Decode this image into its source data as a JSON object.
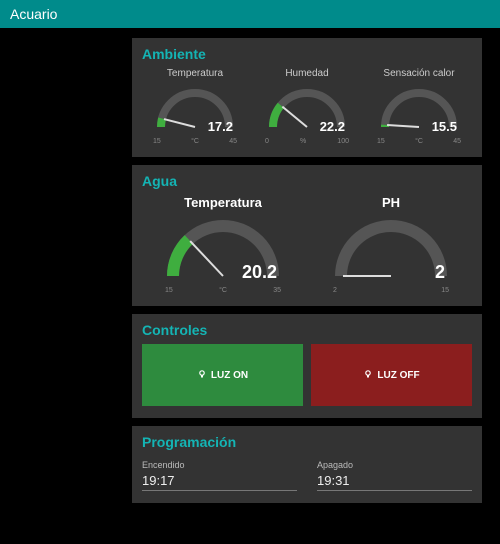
{
  "title": "Acuario",
  "ambiente": {
    "title": "Ambiente",
    "temp": {
      "label": "Temperatura",
      "value": "17.2",
      "min": "15",
      "unit": "°C",
      "max": "45",
      "frac": 0.08
    },
    "hum": {
      "label": "Humedad",
      "value": "22.2",
      "min": "0",
      "unit": "%",
      "max": "100",
      "frac": 0.22
    },
    "feel": {
      "label": "Sensación calor",
      "value": "15.5",
      "min": "15",
      "unit": "°C",
      "max": "45",
      "frac": 0.02
    }
  },
  "agua": {
    "title": "Agua",
    "temp": {
      "label": "Temperatura",
      "value": "20.2",
      "min": "15",
      "unit": "°C",
      "max": "35",
      "frac": 0.26
    },
    "ph": {
      "label": "PH",
      "value": "2",
      "min": "2",
      "unit": "",
      "max": "15",
      "frac": 0.0
    }
  },
  "controles": {
    "title": "Controles",
    "on_label": "LUZ ON",
    "off_label": "LUZ OFF"
  },
  "programacion": {
    "title": "Programación",
    "on": {
      "label": "Encendido",
      "value": "19:17"
    },
    "off": {
      "label": "Apagado",
      "value": "19:31"
    }
  },
  "chart_data": [
    {
      "type": "gauge",
      "title": "Ambiente Temperatura",
      "value": 17.2,
      "min": 15,
      "max": 45,
      "unit": "°C"
    },
    {
      "type": "gauge",
      "title": "Ambiente Humedad",
      "value": 22.2,
      "min": 0,
      "max": 100,
      "unit": "%"
    },
    {
      "type": "gauge",
      "title": "Ambiente Sensación calor",
      "value": 15.5,
      "min": 15,
      "max": 45,
      "unit": "°C"
    },
    {
      "type": "gauge",
      "title": "Agua Temperatura",
      "value": 20.2,
      "min": 15,
      "max": 35,
      "unit": "°C"
    },
    {
      "type": "gauge",
      "title": "Agua PH",
      "value": 2,
      "min": 2,
      "max": 15,
      "unit": ""
    }
  ]
}
